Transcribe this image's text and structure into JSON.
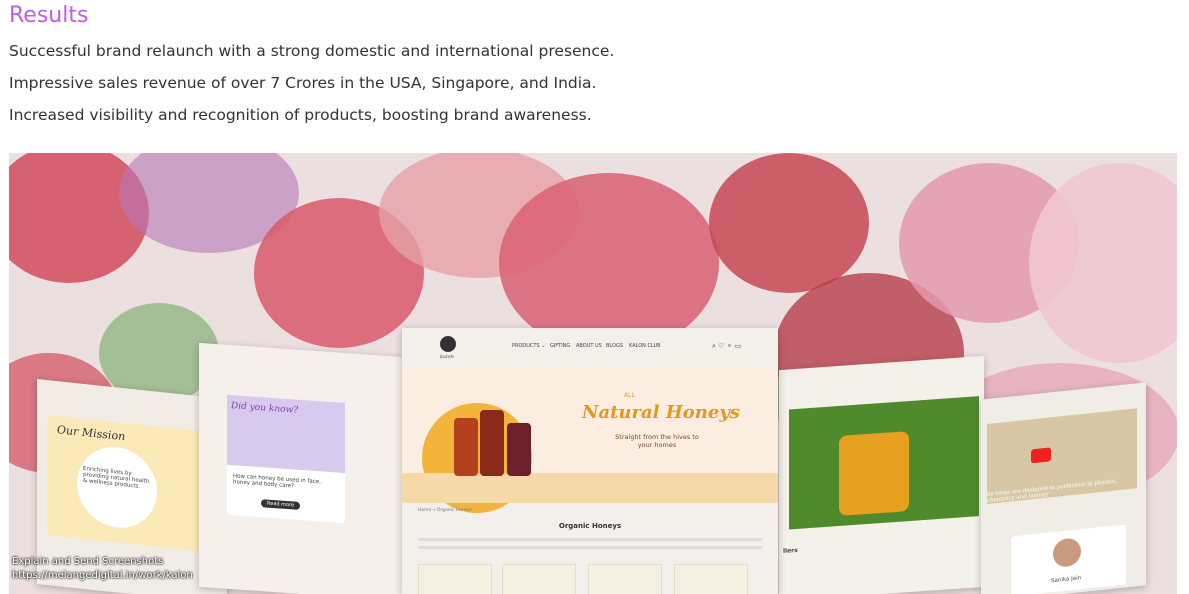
{
  "results": {
    "title": "Results",
    "lines": [
      "Successful brand relaunch with a strong domestic and international presence.",
      "Impressive sales revenue of over 7 Crores in the USA, Singapore, and India.",
      "Increased visibility and recognition of products, boosting brand awareness."
    ]
  },
  "hero": {
    "center_nav": [
      "PRODUCTS ⌄",
      "GIFTING",
      "ABOUT US",
      "BLOGS",
      "KALON CLUB"
    ],
    "brand": "kalon",
    "banner_all": "ALL",
    "banner_title": "Natural Honeys",
    "banner_subtitle": "Straight from the hives to your homes",
    "breadcrumb": "Home » Organic Honeys",
    "section_title": "Organic Honeys",
    "left_mission": "Our Mission",
    "left_mission_text": "Enriching lives by providing natural health & wellness products.",
    "left2_card_title": "Did you know?",
    "left2_card_caption": "How can honey be used in face, honey and body care?",
    "left2_button": "Read more",
    "right1_section": "llers",
    "right2_caption": "he hives are designed to perfection in physics, chemistry and biology",
    "right2_person": "Sanika Jain"
  },
  "overlay": {
    "line1": "Explain and Send Screenshots",
    "line2": "https://melangedigital.in/work/kalon"
  },
  "colors": {
    "title_purple": "#c05ce8",
    "honey_orange": "#f2b43a",
    "honey_text": "#e39a1c"
  }
}
